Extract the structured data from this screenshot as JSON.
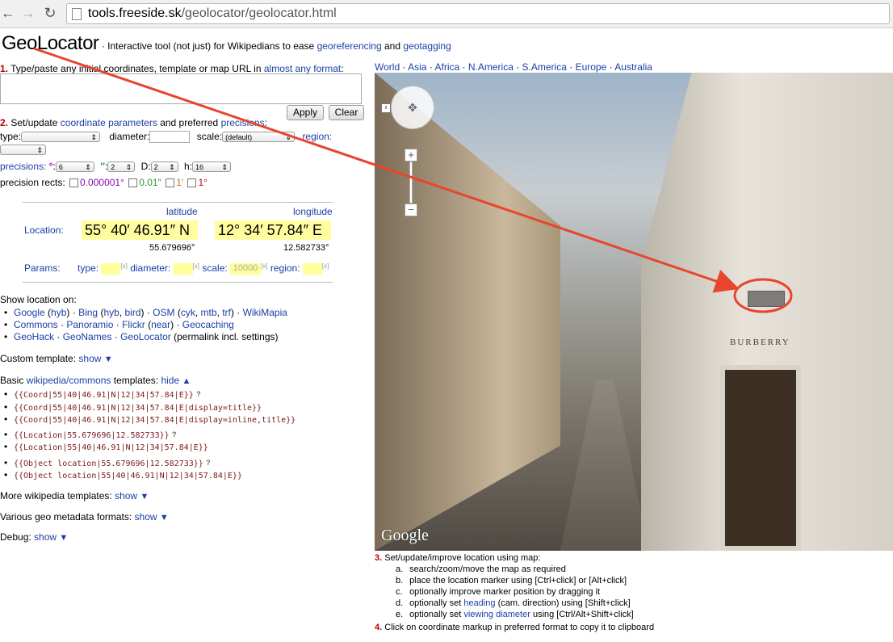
{
  "browser": {
    "url_host": "tools.freeside.sk",
    "url_path": "/geolocator/geolocator.html"
  },
  "header": {
    "title": "GeoLocator",
    "sep": "·",
    "sub_prefix": "Interactive tool (not just) for Wikipedians to ease",
    "link_georef": "georeferencing",
    "and": "and",
    "link_geotag": "geotagging"
  },
  "step1": {
    "num": "1.",
    "text": "Type/paste any initial coordinates, template or map URL in",
    "link": "almost any format",
    "colon": ":",
    "apply": "Apply",
    "clear": "Clear"
  },
  "step2": {
    "num": "2.",
    "text": "Set/update",
    "link1": "coordinate parameters",
    "mid": "and preferred",
    "link2": "precisions",
    "colon": ":",
    "type_label": "type:",
    "diameter_label": "diameter:",
    "scale_label": "scale:",
    "scale_value": "(default)",
    "region_label": "region:",
    "precisions_label": "precisions:",
    "deg_sym": "°",
    "deg_val": "6",
    "sec_sym": "″",
    "sec_val": "2",
    "d_label": "D:",
    "d_val": "2",
    "h_label": "h:",
    "h_val": "16",
    "rects_label": "precision rects:",
    "r1": "0.000001°",
    "r2": "0.01″",
    "r3": "1′",
    "r4": "1°"
  },
  "location": {
    "lat_header": "latitude",
    "lon_header": "longitude",
    "label": "Location:",
    "lat_dms": "55° 40′ 46.91″ N",
    "lon_dms": "12° 34′ 57.84″ E",
    "lat_dec": "55.679696°",
    "lon_dec": "12.582733°",
    "params_label": "Params:",
    "type_label": "type:",
    "diameter_label": "diameter:",
    "scale_label": "scale:",
    "scale_value": "10000",
    "region_label": "region:",
    "x": "[x]"
  },
  "show_on": {
    "title": "Show location on:",
    "line1": {
      "google": "Google",
      "hyb": "hyb",
      "bing": "Bing",
      "bing_hyb": "hyb",
      "bird": "bird",
      "osm": "OSM",
      "cyk": "cyk",
      "mtb": "mtb",
      "trf": "trf",
      "wikimapia": "WikiMapia"
    },
    "line2": {
      "commons": "Commons",
      "panoramio": "Panoramio",
      "flickr": "Flickr",
      "near": "near",
      "geocaching": "Geocaching"
    },
    "line3": {
      "geohack": "GeoHack",
      "geonames": "GeoNames",
      "geolocator": "GeoLocator",
      "permalink": "(permalink incl. settings)"
    }
  },
  "custom": {
    "label": "Custom template:",
    "action": "show"
  },
  "basic": {
    "prefix": "Basic",
    "link": "wikipedia/commons",
    "suffix": "templates:",
    "action": "hide",
    "templates": [
      "{{Coord|55|40|46.91|N|12|34|57.84|E}}",
      "{{Coord|55|40|46.91|N|12|34|57.84|E|display=title}}",
      "{{Coord|55|40|46.91|N|12|34|57.84|E|display=inline,title}}",
      "{{Location|55.679696|12.582733}}",
      "{{Location|55|40|46.91|N|12|34|57.84|E}}",
      "{{Object location|55.679696|12.582733}}",
      "{{Object location|55|40|46.91|N|12|34|57.84|E}}"
    ],
    "qm": "?"
  },
  "more": {
    "label": "More wikipedia templates:",
    "action": "show"
  },
  "various": {
    "label": "Various geo metadata formats:",
    "action": "show"
  },
  "debug": {
    "label": "Debug:",
    "action": "show"
  },
  "regions": [
    "World",
    "Asia",
    "Africa",
    "N.America",
    "S.America",
    "Europe",
    "Australia"
  ],
  "map": {
    "brand": "Google",
    "store_sign": "BURBERRY"
  },
  "step3": {
    "num": "3.",
    "title": "Set/update/improve location using map:",
    "items": [
      {
        "letter": "a.",
        "text": "search/zoom/move the map as required"
      },
      {
        "letter": "b.",
        "text": "place the location marker using [Ctrl+click] or [Alt+click]"
      },
      {
        "letter": "c.",
        "text": "optionally improve marker position by dragging it"
      },
      {
        "letter": "d.",
        "pre": "optionally set",
        "link": "heading",
        "post": "(cam. direction) using [Shift+click]"
      },
      {
        "letter": "e.",
        "pre": "optionally set",
        "link": "viewing diameter",
        "post": "using [Ctrl/Alt+Shift+click]"
      }
    ]
  },
  "step4": {
    "num": "4.",
    "text": "Click on coordinate markup in preferred format to copy it to clipboard"
  },
  "colors": {
    "link": "#1a3fa6",
    "step": "#bb0000",
    "highlight": "#fefea0",
    "annotation": "#e8452f"
  }
}
